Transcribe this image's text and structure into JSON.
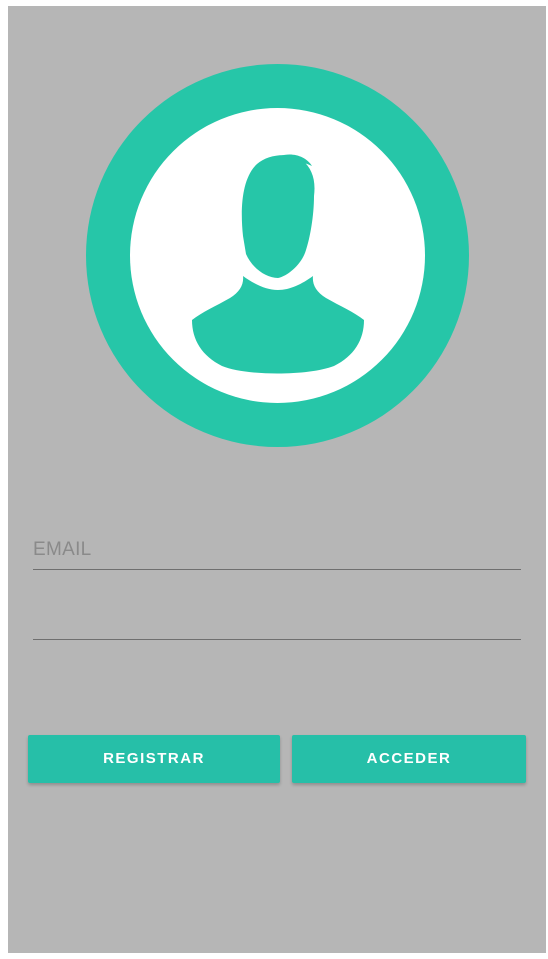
{
  "theme": {
    "accent": "#26c6a8",
    "background": "#b6b6b6",
    "avatar_background": "#ffffff"
  },
  "avatar": {
    "icon": "user-silhouette-icon"
  },
  "form": {
    "email": {
      "placeholder": "EMAIL",
      "value": ""
    },
    "password": {
      "placeholder": "",
      "value": ""
    }
  },
  "actions": {
    "register_label": "REGISTRAR",
    "login_label": "ACCEDER"
  }
}
